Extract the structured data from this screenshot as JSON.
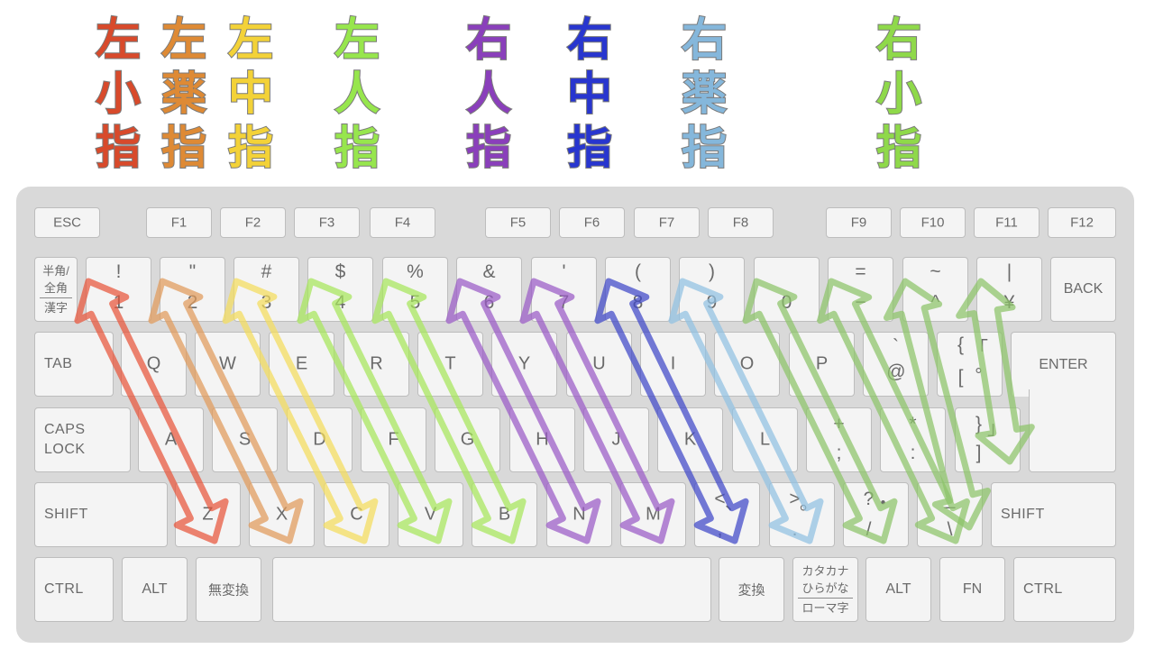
{
  "finger_labels": [
    {
      "id": "left-pinky",
      "chars": [
        "左",
        "小",
        "指"
      ],
      "color": "#d84a2b"
    },
    {
      "id": "left-ring",
      "chars": [
        "左",
        "薬",
        "指"
      ],
      "color": "#de8a35"
    },
    {
      "id": "left-middle",
      "chars": [
        "左",
        "中",
        "指"
      ],
      "color": "#f3d238"
    },
    {
      "id": "left-index",
      "chars": [
        "左",
        "人",
        "指"
      ],
      "color": "#97e64d"
    },
    {
      "id": "right-index",
      "chars": [
        "右",
        "人",
        "指"
      ],
      "color": "#8a3fbb"
    },
    {
      "id": "right-middle",
      "chars": [
        "右",
        "中",
        "指"
      ],
      "color": "#2836cf"
    },
    {
      "id": "right-ring",
      "chars": [
        "右",
        "薬",
        "指"
      ],
      "color": "#85b7db"
    },
    {
      "id": "right-pinky",
      "chars": [
        "右",
        "小",
        "指"
      ],
      "color": "#8fd94a"
    }
  ],
  "keys": {
    "esc": "ESC",
    "f": [
      "F1",
      "F2",
      "F3",
      "F4",
      "F5",
      "F6",
      "F7",
      "F8",
      "F9",
      "F10",
      "F11",
      "F12"
    ],
    "hankaku": [
      "半角/",
      "全角",
      "漢字"
    ],
    "num": [
      {
        "top": "!",
        "bottom": "1"
      },
      {
        "top": "\"",
        "bottom": "2"
      },
      {
        "top": "#",
        "bottom": "3"
      },
      {
        "top": "$",
        "bottom": "4"
      },
      {
        "top": "%",
        "bottom": "5"
      },
      {
        "top": "&",
        "bottom": "6"
      },
      {
        "top": "'",
        "bottom": "7"
      },
      {
        "top": "(",
        "bottom": "8"
      },
      {
        "top": ")",
        "bottom": "9"
      },
      {
        "top": "",
        "bottom": "0"
      },
      {
        "top": "=",
        "bottom": "−"
      },
      {
        "top": "~",
        "bottom": "^"
      },
      {
        "top": "|",
        "bottom": "¥"
      }
    ],
    "back": "BACK",
    "tab": "TAB",
    "qrow": [
      "Q",
      "W",
      "E",
      "R",
      "T",
      "Y",
      "U",
      "I",
      "O",
      "P"
    ],
    "at": {
      "top": "`",
      "bottom": "@"
    },
    "bracket_open": {
      "tl": "{",
      "tr": "「",
      "bl": "[",
      "br": "°"
    },
    "enter": "ENTER",
    "caps": [
      "CAPS",
      "LOCK"
    ],
    "arow": [
      "A",
      "S",
      "D",
      "F",
      "G",
      "H",
      "J",
      "K",
      "L"
    ],
    "semicolon": {
      "top": "+",
      "bottom": ";"
    },
    "colon": {
      "top": "*",
      "bottom": ":"
    },
    "bracket_close": {
      "tl": "}",
      "tr": "」",
      "bl": "]",
      "br": ""
    },
    "shift": "SHIFT",
    "zrow": [
      "Z",
      "X",
      "C",
      "V",
      "B",
      "N",
      "M"
    ],
    "comma": {
      "tl": "<",
      "tr": "、",
      "bl": ",",
      "br": ""
    },
    "period": {
      "tl": ">",
      "tr": "。",
      "bl": ".",
      "br": ""
    },
    "slash": {
      "tl": "?",
      "tr": "・",
      "bl": "/",
      "br": ""
    },
    "backslash": {
      "tl": "_",
      "tr": "",
      "bl": "\\",
      "br": ""
    },
    "shift_right": "SHIFT",
    "ctrl": "CTRL",
    "alt": "ALT",
    "muhenkan": "無変換",
    "henkan": "変換",
    "kana": [
      "カタカナ",
      "ひらがな",
      "ローマ字"
    ],
    "alt_right": "ALT",
    "fn": "FN",
    "ctrl_right": "CTRL"
  },
  "zone_colors": [
    "#e8553a",
    "#e09a5a",
    "#f4dc5c",
    "#a6e65a",
    "#a6e65a",
    "#9a5ac6",
    "#9a5ac6",
    "#3f46c8",
    "#90c1e2",
    "#8cc468",
    "#8cc468",
    "#8cc468",
    "#8cc468"
  ]
}
